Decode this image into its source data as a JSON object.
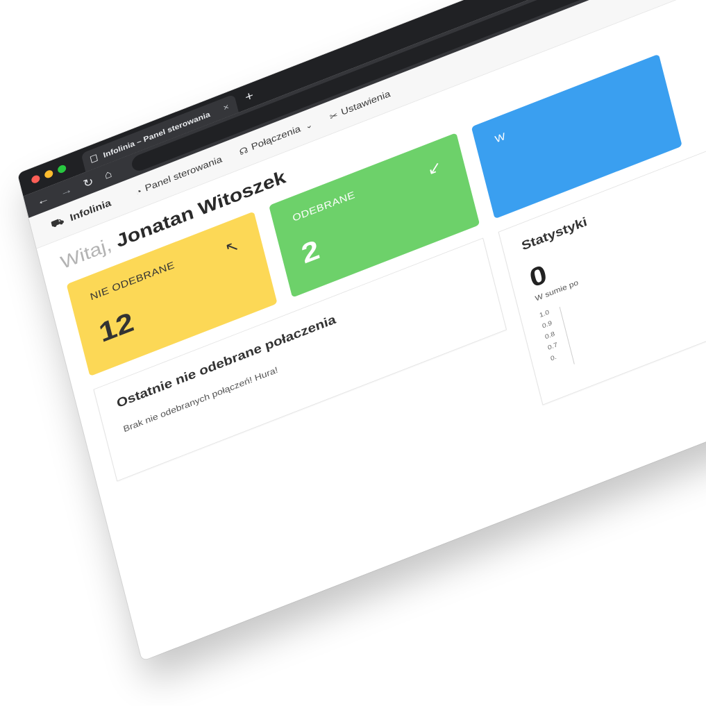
{
  "browser": {
    "tab_title": "Infolinia – Panel sterowania",
    "close_glyph": "×",
    "newtab_glyph": "+",
    "back_glyph": "←",
    "forward_glyph": "→",
    "reload_glyph": "↻",
    "home_glyph": "⌂"
  },
  "nav": {
    "brand": "Infolinia",
    "items": [
      {
        "label": "Panel sterowania",
        "icon": "dashboard-icon"
      },
      {
        "label": "Połączenia",
        "icon": "headset-icon"
      },
      {
        "label": "Ustawienia",
        "icon": "tools-icon"
      }
    ],
    "chevron": "⌄"
  },
  "greeting": {
    "hello": "Witaj,",
    "name": "Jonatan Witoszek"
  },
  "cards": [
    {
      "label": "NIE ODEBRANE",
      "value": "12",
      "icon_glyph": "↖",
      "color": "#fcd856"
    },
    {
      "label": "ODEBRANE",
      "value": "2",
      "icon_glyph": "↙",
      "color": "#6dd16a"
    },
    {
      "label": "W",
      "value": "",
      "icon_glyph": "",
      "color": "#3a9ff0"
    }
  ],
  "missed_panel": {
    "title": "Ostatnie nie odebrane połaczenia",
    "message": "Brak nie odebranych połączeń! Hura!"
  },
  "stats_panel": {
    "title": "Statystyki",
    "big_value": "0",
    "sub_label": "W sumie po",
    "y_ticks": [
      "1.0",
      "0.9",
      "0.8",
      "0.7",
      "0."
    ]
  }
}
